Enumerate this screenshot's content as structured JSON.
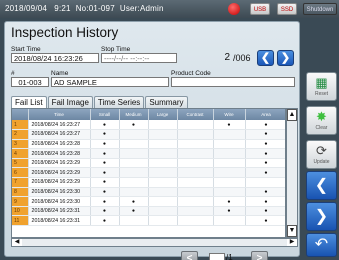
{
  "statusbar": {
    "datetime": "2018/09/04   9:21",
    "number": "No:01-097",
    "user": "User:Admin",
    "usb_label": "USB",
    "ssd_label": "SSD",
    "shutdown_label": "Shutdown"
  },
  "title": "Inspection History",
  "filters": {
    "start_time_label": "Start Time",
    "start_time_value": "2018/08/24 16:23:26",
    "stop_time_label": "Stop Time",
    "stop_time_value": "----/--/-- --:--:--",
    "page_current": "2",
    "page_total": "/006",
    "number_label": "#",
    "number_value": "01-003",
    "name_label": "Name",
    "name_value": "AD SAMPLE",
    "product_code_label": "Product Code",
    "product_code_value": ""
  },
  "tabs": [
    "Fail List",
    "Fail Image",
    "Time Series",
    "Summary"
  ],
  "table": {
    "columns": [
      "",
      "Time",
      "Small",
      "Medium",
      "Large",
      "Contrast",
      "Wire",
      "Area"
    ],
    "rows": [
      {
        "idx": "1",
        "time": "2018/08/24 16:23:27",
        "marks": [
          "●",
          "●",
          "",
          "",
          "●",
          "●"
        ]
      },
      {
        "idx": "2",
        "time": "2018/08/24 16:23:27",
        "marks": [
          "●",
          "",
          "",
          "",
          "",
          "●"
        ]
      },
      {
        "idx": "3",
        "time": "2018/08/24 16:23:28",
        "marks": [
          "●",
          "",
          "",
          "",
          "",
          "●"
        ]
      },
      {
        "idx": "4",
        "time": "2018/08/24 16:23:28",
        "marks": [
          "●",
          "",
          "",
          "",
          "",
          "●"
        ]
      },
      {
        "idx": "5",
        "time": "2018/08/24 16:23:29",
        "marks": [
          "●",
          "",
          "",
          "",
          "",
          "●"
        ]
      },
      {
        "idx": "6",
        "time": "2018/08/24 16:23:29",
        "marks": [
          "●",
          "",
          "",
          "",
          "",
          "●"
        ]
      },
      {
        "idx": "7",
        "time": "2018/08/24 16:23:29",
        "marks": [
          "●",
          "",
          "",
          "",
          "",
          ""
        ]
      },
      {
        "idx": "8",
        "time": "2018/08/24 16:23:30",
        "marks": [
          "●",
          "",
          "",
          "",
          "",
          "●"
        ]
      },
      {
        "idx": "9",
        "time": "2018/08/24 16:23:30",
        "marks": [
          "●",
          "●",
          "",
          "",
          "●",
          "●"
        ]
      },
      {
        "idx": "10",
        "time": "2018/08/24 16:23:31",
        "marks": [
          "●",
          "●",
          "",
          "",
          "●",
          "●"
        ]
      },
      {
        "idx": "11",
        "time": "2018/08/24 16:23:31",
        "marks": [
          "●",
          "",
          "",
          "",
          "",
          "●"
        ]
      }
    ]
  },
  "pager": {
    "prev_glyph": "<",
    "next_glyph": ">",
    "current": "",
    "total": "/1"
  },
  "sidebar": {
    "reset_label": "Reset",
    "clear_label": "Clear",
    "update_label": "Update",
    "reset_icon": "excel-export-icon",
    "clear_icon": "sparkle-clear-icon",
    "update_icon": "refresh-icon"
  },
  "colors": {
    "accent_blue": "#1b57b8",
    "row_index_orange": "#f0a22e",
    "alarm_red": "#c40000"
  }
}
